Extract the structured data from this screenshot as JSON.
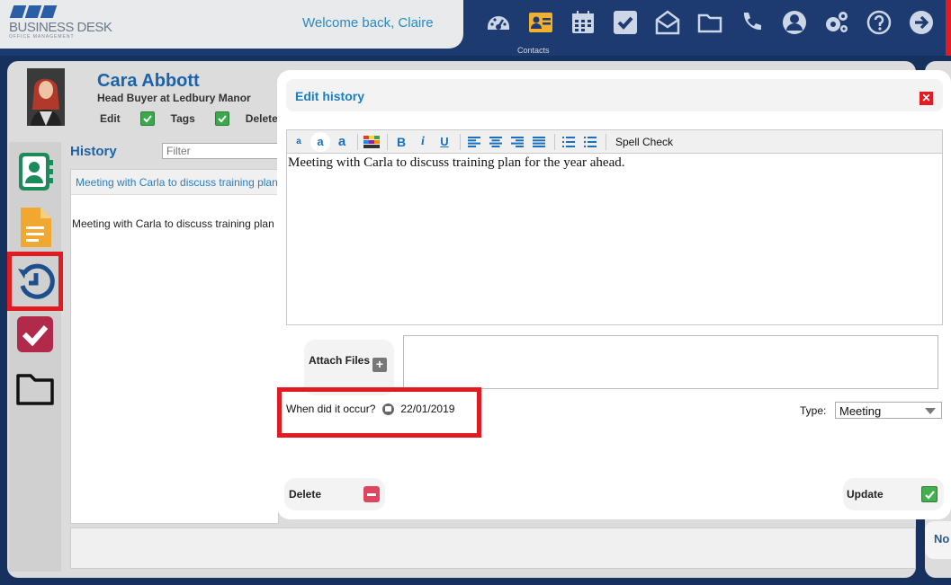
{
  "app": {
    "brand_name": "BUSINESS DESK",
    "brand_sub": "OFFICE MANAGEMENT",
    "welcome": "Welcome back, Claire",
    "active_nav_caption": "Contacts"
  },
  "nav": [
    {
      "name": "dashboard-icon"
    },
    {
      "name": "contacts-icon"
    },
    {
      "name": "calendar-icon"
    },
    {
      "name": "tasks-icon"
    },
    {
      "name": "mail-icon"
    },
    {
      "name": "folder-icon"
    },
    {
      "name": "phone-icon"
    },
    {
      "name": "user-icon"
    },
    {
      "name": "settings-icon"
    },
    {
      "name": "help-icon"
    },
    {
      "name": "logout-icon"
    }
  ],
  "contact": {
    "name": "Cara Abbott",
    "role": "Head Buyer at Ledbury Manor",
    "actions": {
      "edit": "Edit",
      "tags": "Tags",
      "delete": "Delete"
    }
  },
  "history": {
    "title": "History",
    "filter_placeholder": "Filter",
    "entry_title": "Meeting with Carla to discuss training plan for the year ahead.",
    "entry_body": "Meeting with Carla to discuss training plan for the year ahead."
  },
  "side_no_label": "No",
  "modal": {
    "title": "Edit history",
    "close_symbol": "✕",
    "toolbar": {
      "font_small": "a",
      "font_medium": "a",
      "font_large": "a",
      "bold": "B",
      "italic": "i",
      "underline": "U",
      "spell_check": "Spell Check"
    },
    "editor_text": "Meeting with Carla to discuss training plan for the year ahead.",
    "attach_label": "Attach Files",
    "attach_plus": "+",
    "when_label": "When did it occur?",
    "when_date": "22/01/2019",
    "type_label": "Type:",
    "type_value": "Meeting",
    "delete_label": "Delete",
    "update_label": "Update"
  },
  "colors": {
    "accent_blue": "#1a7fc4",
    "highlight_red": "#e01b22",
    "nav_bg": "#1d3b70"
  }
}
